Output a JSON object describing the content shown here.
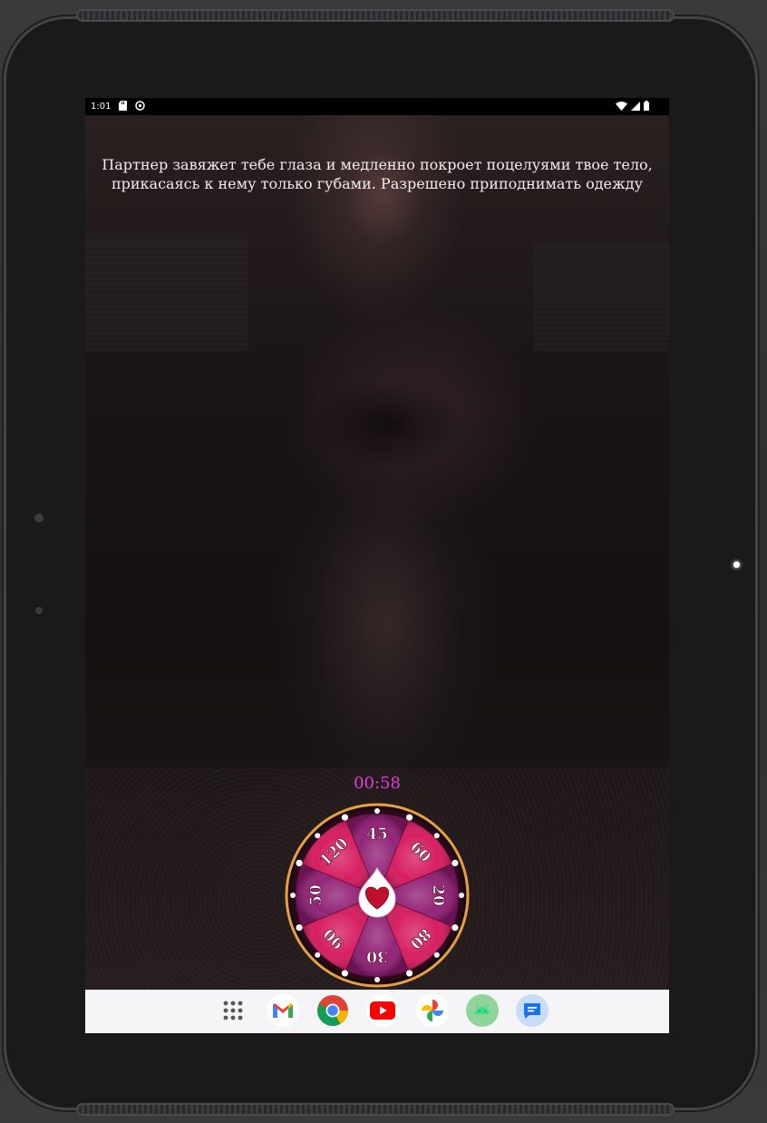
{
  "status_bar": {
    "time": "1:01",
    "left_icons": [
      "sd-card-icon",
      "sync-icon"
    ],
    "right_icons": [
      "wifi-icon",
      "signal-icon",
      "battery-icon"
    ]
  },
  "task": {
    "line1": "Партнер завяжет тебе глаза и медленно покроет поцелуями твое тело,",
    "line2": "прикасаясь к нему только губами. Разрешено приподнимать одежду"
  },
  "timer": {
    "value": "00:58"
  },
  "wheel": {
    "labels": [
      "60",
      "20",
      "80",
      "30",
      "90",
      "50",
      "120",
      "45"
    ],
    "center_icon": "heart-icon",
    "colors": {
      "primary": "#d4145a",
      "secondary": "#8e1a72",
      "rim": "#e8a040"
    }
  },
  "dock": {
    "apps": [
      {
        "name": "app-drawer",
        "icon": "app-grid-icon"
      },
      {
        "name": "gmail",
        "icon": "gmail-icon"
      },
      {
        "name": "chrome",
        "icon": "chrome-icon"
      },
      {
        "name": "youtube",
        "icon": "youtube-icon"
      },
      {
        "name": "photos",
        "icon": "photos-icon"
      },
      {
        "name": "android",
        "icon": "android-icon"
      },
      {
        "name": "messages",
        "icon": "messages-icon"
      }
    ]
  }
}
